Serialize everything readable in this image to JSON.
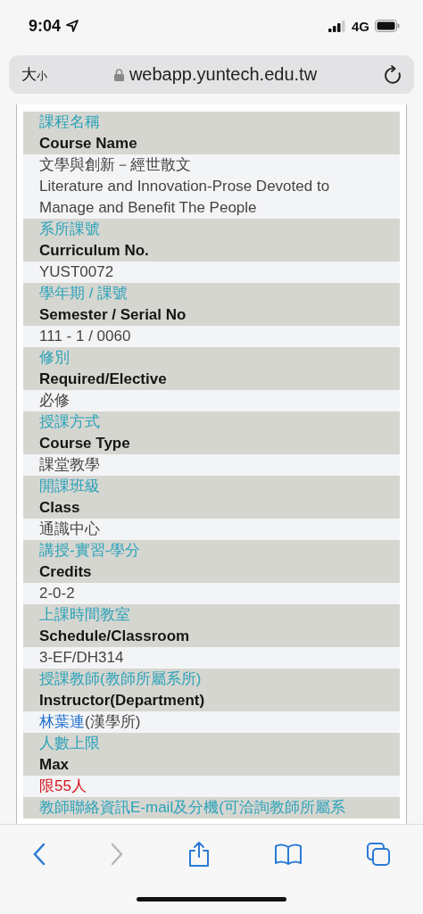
{
  "status_bar": {
    "time": "9:04",
    "network": "4G"
  },
  "address_bar": {
    "text_size_button": "大小",
    "url": "webapp.yuntech.edu.tw"
  },
  "fields": [
    {
      "label_zh": "課程名稱",
      "label_en": "Course Name",
      "value_lines": [
        [
          {
            "text": "文學與創新－經世散文",
            "kind": "plain"
          }
        ],
        [
          {
            "text": "Literature and Innovation-Prose Devoted to Manage and Benefit The People",
            "kind": "plain"
          }
        ]
      ]
    },
    {
      "label_zh": "系所課號",
      "label_en": "Curriculum No.",
      "value_lines": [
        [
          {
            "text": "YUST0072",
            "kind": "plain"
          }
        ]
      ]
    },
    {
      "label_zh": "學年期 / 課號",
      "label_en": "Semester / Serial No",
      "value_lines": [
        [
          {
            "text": "111  - 1 / 0060",
            "kind": "plain"
          }
        ]
      ]
    },
    {
      "label_zh": "修別",
      "label_en": "Required/Elective",
      "value_lines": [
        [
          {
            "text": "必修",
            "kind": "plain"
          }
        ]
      ]
    },
    {
      "label_zh": "授課方式",
      "label_en": "Course Type",
      "value_lines": [
        [
          {
            "text": "課堂教學",
            "kind": "plain"
          }
        ]
      ]
    },
    {
      "label_zh": "開課班級",
      "label_en": "Class",
      "value_lines": [
        [
          {
            "text": "通識中心",
            "kind": "plain"
          }
        ]
      ]
    },
    {
      "label_zh": "講授-實習-學分",
      "label_en": "Credits",
      "value_lines": [
        [
          {
            "text": "2-0-2",
            "kind": "plain"
          }
        ]
      ]
    },
    {
      "label_zh": "上課時間教室",
      "label_en": "Schedule/Classroom",
      "value_lines": [
        [
          {
            "text": "3-EF/DH314",
            "kind": "plain"
          }
        ]
      ]
    },
    {
      "label_zh": "授課教師(教師所屬系所)",
      "label_en": "Instructor(Department)",
      "value_lines": [
        [
          {
            "text": "林葉連",
            "kind": "link"
          },
          {
            "text": "(漢學所)",
            "kind": "plain"
          }
        ]
      ]
    },
    {
      "label_zh": "人數上限",
      "label_en": "Max",
      "value_lines": [
        [
          {
            "text": "限55人",
            "kind": "alert"
          }
        ]
      ]
    },
    {
      "label_zh": "教師聯絡資訊E-mail及分機(可洽詢教師所屬系"
    }
  ],
  "toolbar": [
    {
      "kind": "back",
      "disabled": false
    },
    {
      "kind": "forward",
      "disabled": true
    },
    {
      "kind": "share",
      "disabled": false
    },
    {
      "kind": "bookmarks",
      "disabled": false
    },
    {
      "kind": "tabs",
      "disabled": false
    }
  ]
}
